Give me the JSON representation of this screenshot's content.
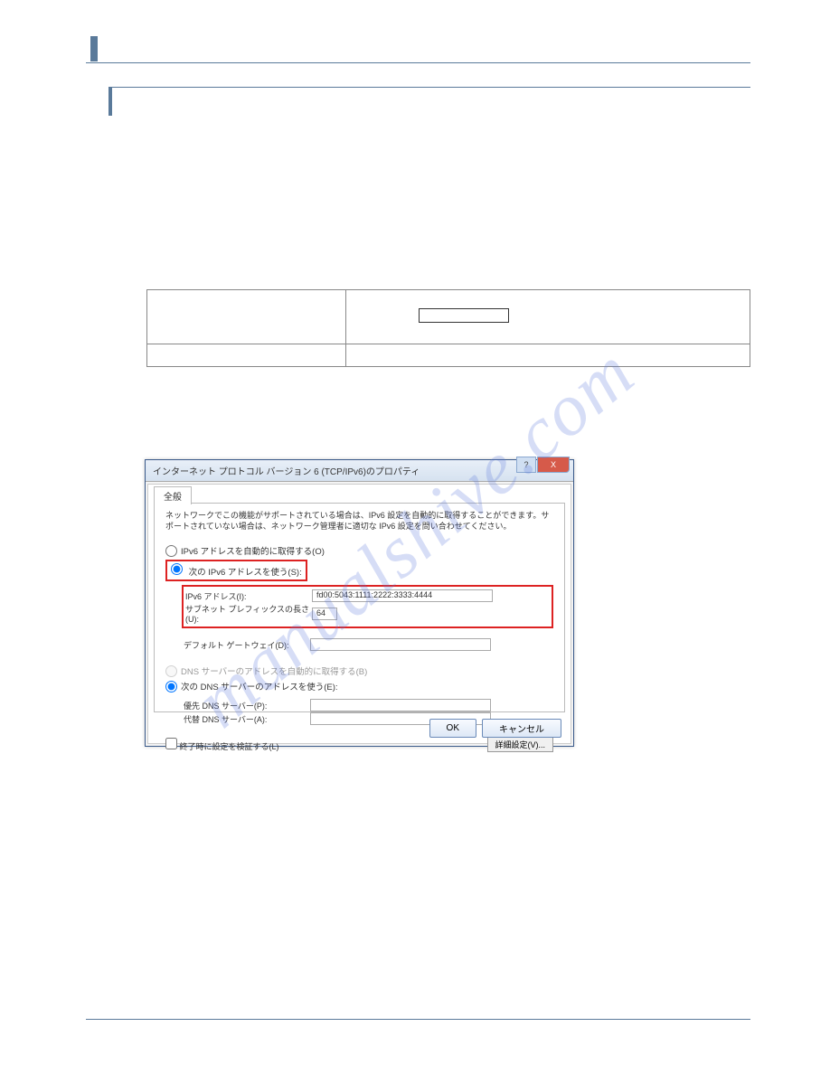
{
  "dialog": {
    "title": "インターネット プロトコル バージョン 6 (TCP/IPv6)のプロパティ",
    "tab": "全般",
    "description": "ネットワークでこの機能がサポートされている場合は、IPv6 設定を自動的に取得することができます。サポートされていない場合は、ネットワーク管理者に適切な IPv6 設定を問い合わせてください。",
    "radio_auto_ip": "IPv6 アドレスを自動的に取得する(O)",
    "radio_manual_ip": "次の IPv6 アドレスを使う(S):",
    "label_ipv6": "IPv6 アドレス(I):",
    "value_ipv6": "fd00:5043:1111:2222:3333:4444",
    "label_prefix": "サブネット プレフィックスの長さ(U):",
    "value_prefix": "64",
    "label_gateway": "デフォルト ゲートウェイ(D):",
    "radio_auto_dns": "DNS サーバーのアドレスを自動的に取得する(B)",
    "radio_manual_dns": "次の DNS サーバーのアドレスを使う(E):",
    "label_dns1": "優先 DNS サーバー(P):",
    "label_dns2": "代替 DNS サーバー(A):",
    "checkbox_validate": "終了時に設定を検証する(L)",
    "btn_advanced": "詳細設定(V)...",
    "btn_ok": "OK",
    "btn_cancel": "キャンセル",
    "help_icon": "?",
    "close_icon": "X"
  },
  "watermark": "manualshive.com"
}
